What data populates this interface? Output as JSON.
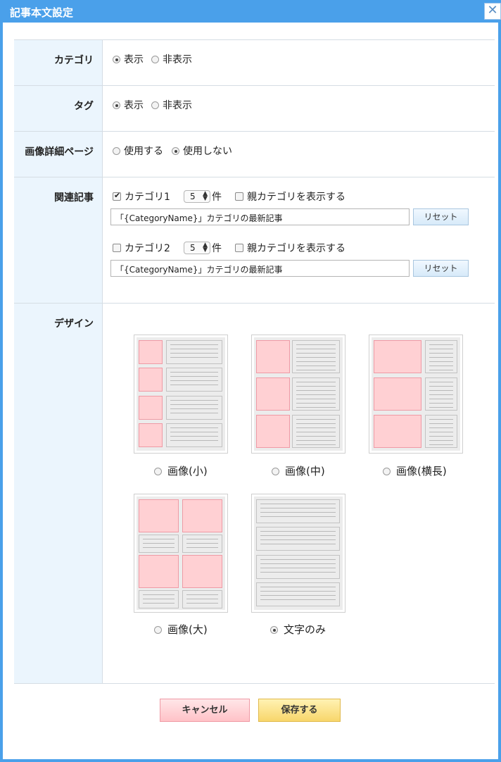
{
  "dialog": {
    "title": "記事本文設定",
    "close_label": "✕"
  },
  "category": {
    "label": "カテゴリ",
    "options": [
      {
        "label": "表示",
        "selected": true
      },
      {
        "label": "非表示",
        "selected": false
      }
    ]
  },
  "tag": {
    "label": "タグ",
    "options": [
      {
        "label": "表示",
        "selected": true
      },
      {
        "label": "非表示",
        "selected": false
      }
    ]
  },
  "image_page": {
    "label": "画像詳細ページ",
    "options": [
      {
        "label": "使用する",
        "selected": false
      },
      {
        "label": "使用しない",
        "selected": true
      }
    ]
  },
  "related": {
    "label": "関連記事",
    "items": [
      {
        "label": "カテゴリ1",
        "checked": true,
        "count": "5",
        "unit": "件",
        "parent_label": "親カテゴリを表示する",
        "parent_checked": false,
        "title_value": "「{CategoryName}」カテゴリの最新記事",
        "reset_label": "リセット"
      },
      {
        "label": "カテゴリ2",
        "checked": false,
        "count": "5",
        "unit": "件",
        "parent_label": "親カテゴリを表示する",
        "parent_checked": false,
        "title_value": "「{CategoryName}」カテゴリの最新記事",
        "reset_label": "リセット"
      }
    ]
  },
  "design": {
    "label": "デザイン",
    "options": [
      {
        "label": "画像(小)",
        "selected": false
      },
      {
        "label": "画像(中)",
        "selected": false
      },
      {
        "label": "画像(横長)",
        "selected": false
      },
      {
        "label": "画像(大)",
        "selected": false
      },
      {
        "label": "文字のみ",
        "selected": true
      }
    ]
  },
  "footer": {
    "cancel_label": "キャンセル",
    "save_label": "保存する"
  },
  "colors": {
    "title_bar": "#4aa0ea",
    "label_bg": "#ebf5fd",
    "image_placeholder": "#ffd0d3"
  }
}
